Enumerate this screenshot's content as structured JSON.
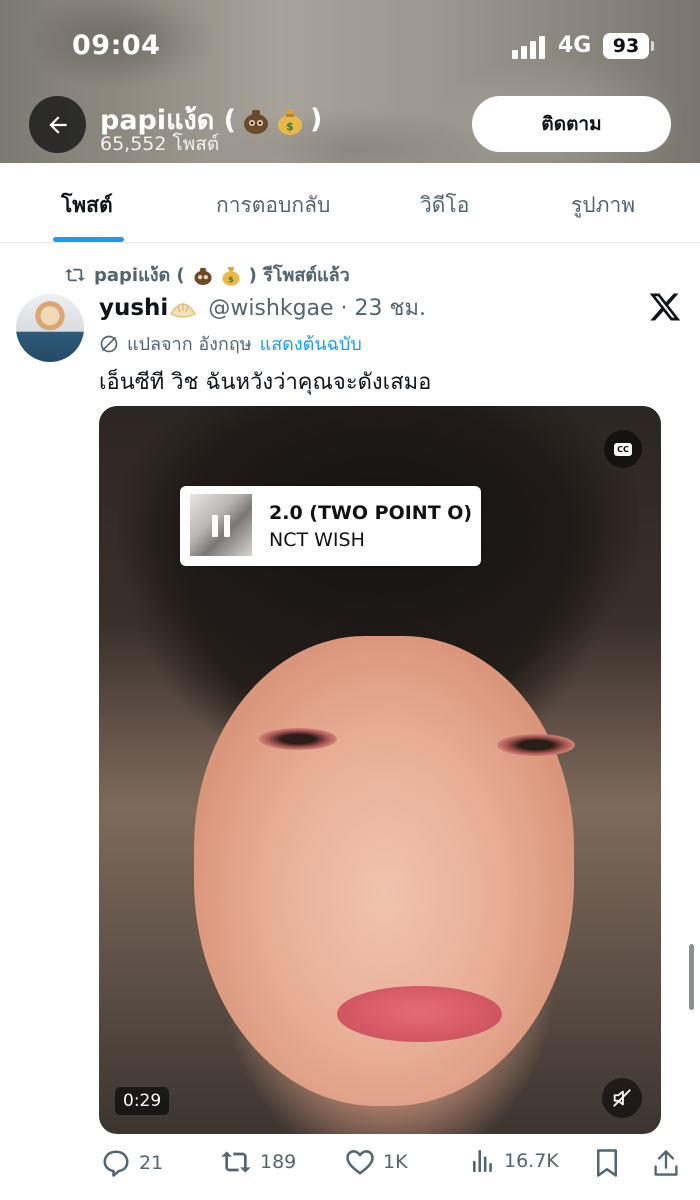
{
  "status_bar": {
    "time": "09:04",
    "network": "4G",
    "battery": "93"
  },
  "profile": {
    "name": "papiแง้ด (",
    "name_close": ")",
    "name_emojis": [
      "money-bag-sloth-icon",
      "money-bag-icon"
    ],
    "post_count": "65,552 โพสต์",
    "follow_label": "ติดตาม"
  },
  "tabs": [
    {
      "label": "โพสต์",
      "active": true
    },
    {
      "label": "การตอบกลับ",
      "active": false
    },
    {
      "label": "วิดีโอ",
      "active": false
    },
    {
      "label": "รูปภาพ",
      "active": false
    }
  ],
  "tweet": {
    "repost_prefix": "papiแง้ด (",
    "repost_suffix": ") รีโพสต์แล้ว",
    "author_name": "yushi",
    "author_emoji": "dumpling-icon",
    "handle_time": "@wishkgae · 23 ชม.",
    "translated_from": "แปลจาก อังกฤษ",
    "show_original": "แสดงต้นฉบับ",
    "text": "เอ็นซีที วิช ฉันหวังว่าคุณจะดังเสมอ",
    "media": {
      "song_title": "2.0 (TWO POINT O)",
      "song_artist": "NCT WISH",
      "duration": "0:29"
    },
    "stats": {
      "replies": "21",
      "reposts": "189",
      "likes": "1K",
      "views": "16.7K"
    }
  },
  "colors": {
    "accent": "#1d9bf0",
    "text_primary": "#0f1419",
    "text_secondary": "#536471"
  }
}
